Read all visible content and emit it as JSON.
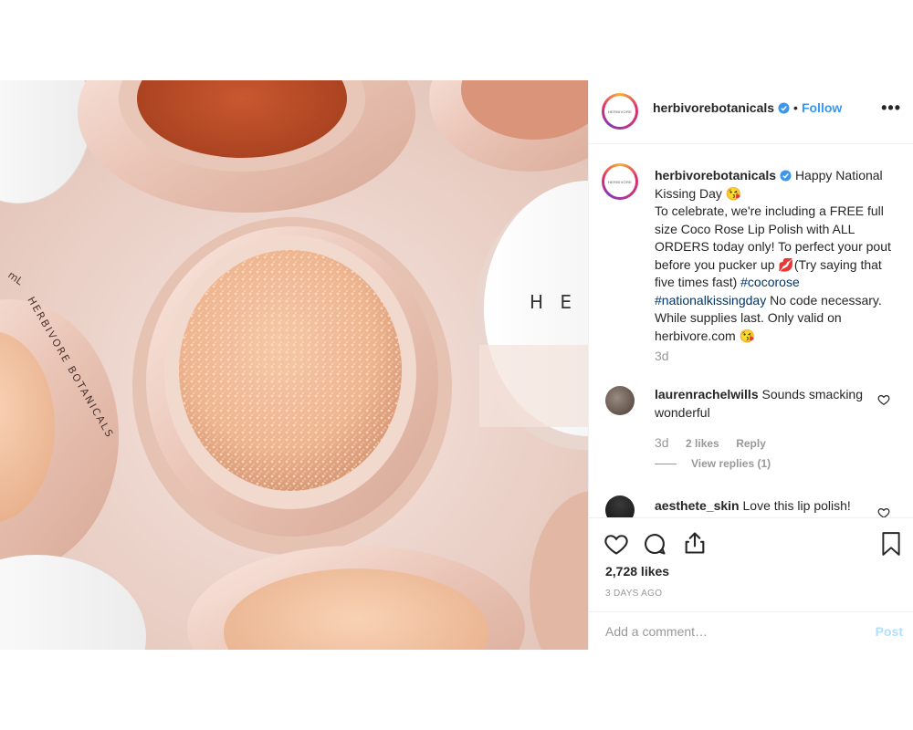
{
  "post": {
    "username": "herbivorebotanicals",
    "follow_label": "Follow",
    "dot": "•",
    "more_label": "•••",
    "avatar_logo_text": "HERBIVORE",
    "jar_brand_text": "HERBIVORE BOTANICALS",
    "jar_volume_text": "mL",
    "lid_text": "H E",
    "caption": {
      "username": "herbivorebotanicals",
      "line1": "Happy National Kissing Day",
      "emoji1": "😘",
      "body": "To celebrate, we're including a FREE full size Coco Rose Lip Polish with ALL ORDERS today only! To perfect your pout before you pucker up",
      "emoji2": "💋",
      "body2": "(Try saying that five times fast)",
      "hashtag1": "#cocorose",
      "hashtag2": "#nationalkissingday",
      "body3": "No code necessary. While supplies last. Only valid on herbivore.com",
      "emoji3": "😘",
      "age": "3d"
    },
    "comments": [
      {
        "username": "laurenrachelwills",
        "text": "Sounds smacking wonderful",
        "age": "3d",
        "likes": "2 likes",
        "reply": "Reply",
        "view_replies": "View replies (1)"
      },
      {
        "username": "aesthete_skin",
        "text": "Love this lip polish!"
      }
    ],
    "likes_count": "2,728 likes",
    "date": "3 DAYS AGO",
    "add_comment_placeholder": "Add a comment…",
    "post_label": "Post",
    "colors": {
      "link": "#3897f0",
      "hashtag": "#003569",
      "muted": "#999999",
      "post_disabled": "#b2dffc"
    }
  }
}
